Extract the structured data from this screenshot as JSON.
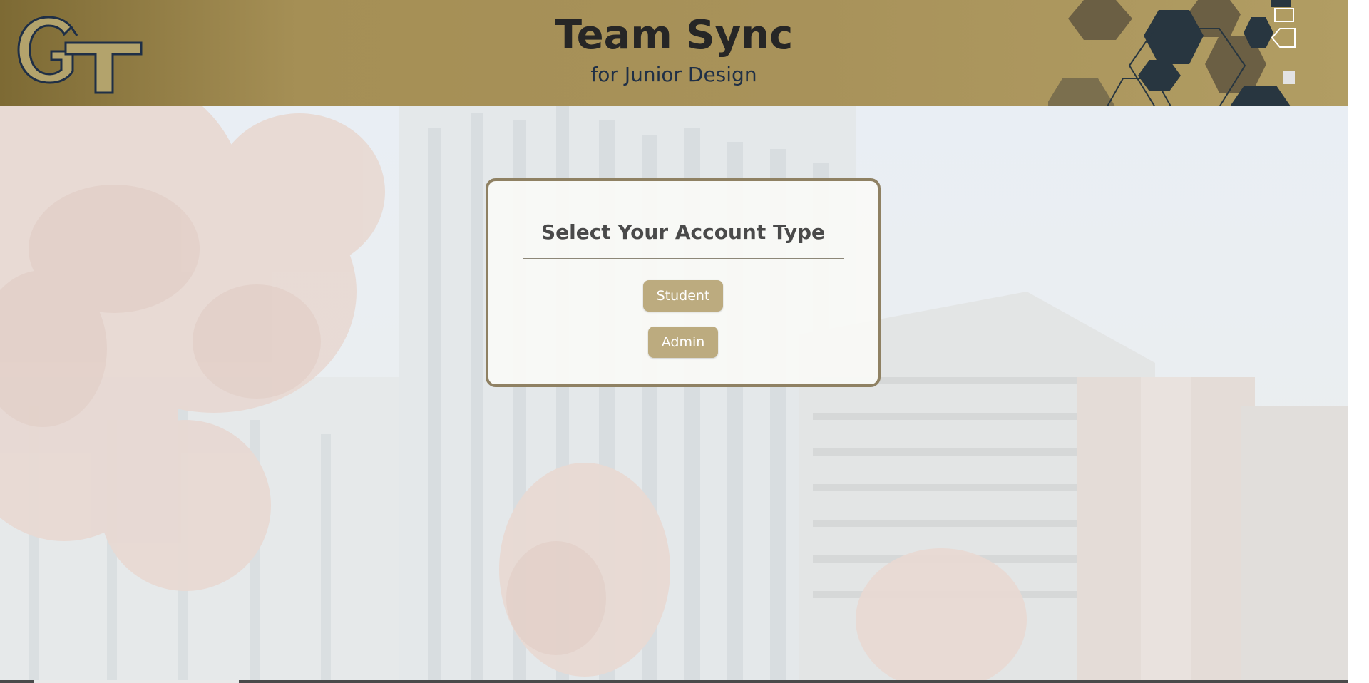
{
  "header": {
    "logo_text": "GT",
    "title": "Team Sync",
    "subtitle": "for Junior Design"
  },
  "account_select": {
    "heading": "Select Your Account Type",
    "buttons": {
      "student": "Student",
      "admin": "Admin"
    }
  },
  "colors": {
    "header_gold": "#a8925a",
    "button_gold": "#bcab7f",
    "card_border": "#8f8163",
    "navy": "#1f2f46",
    "title_dark": "#262626"
  }
}
